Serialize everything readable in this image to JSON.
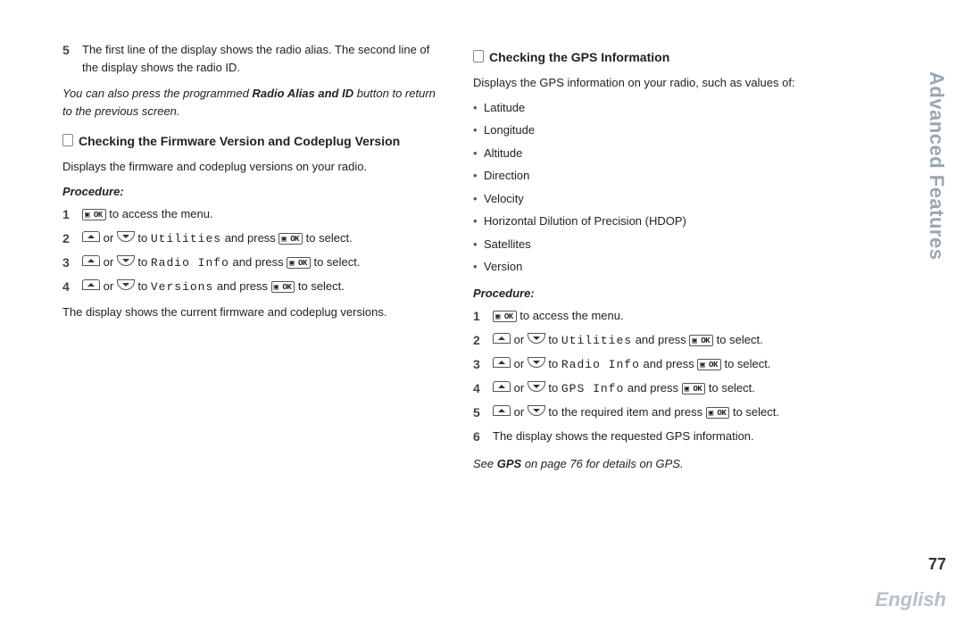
{
  "sideTab": "Advanced Features",
  "pageNumber": "77",
  "language": "English",
  "left": {
    "step5": {
      "num": "5",
      "text": "The first line of the display shows the radio alias. The second line of the display shows the radio ID."
    },
    "note_pre": "You can also press the programmed ",
    "note_bold": "Radio Alias and ID",
    "note_post": " button to return to the previous screen.",
    "section_title": "Checking the Firmware Version and Codeplug Version",
    "intro": "Displays the firmware and codeplug versions on your radio.",
    "procedure_label": "Procedure:",
    "steps": {
      "s1": {
        "num": "1",
        "tail": " to access the menu."
      },
      "s2": {
        "num": "2",
        "mid1": " or ",
        "mid2": " to ",
        "target": "Utilities",
        "mid3": " and press ",
        "tail": " to select."
      },
      "s3": {
        "num": "3",
        "mid1": " or ",
        "mid2": " to ",
        "target": "Radio Info",
        "mid3": " and press ",
        "tail": " to select."
      },
      "s4": {
        "num": "4",
        "mid1": " or ",
        "mid2": " to ",
        "target": "Versions",
        "mid3": " and press ",
        "tail": " to select."
      }
    },
    "outro": "The display shows the current firmware and codeplug versions."
  },
  "right": {
    "section_title": "Checking the GPS Information",
    "intro": "Displays the GPS information on your radio, such as values of:",
    "bullets": [
      "Latitude",
      "Longitude",
      "Altitude",
      "Direction",
      "Velocity",
      "Horizontal Dilution of Precision (HDOP)",
      "Satellites",
      "Version"
    ],
    "procedure_label": "Procedure:",
    "steps": {
      "s1": {
        "num": "1",
        "tail": " to access the menu."
      },
      "s2": {
        "num": "2",
        "mid1": " or ",
        "mid2": " to ",
        "target": "Utilities",
        "mid3": " and press ",
        "tail": " to select."
      },
      "s3": {
        "num": "3",
        "mid1": " or ",
        "mid2": " to ",
        "target": "Radio Info",
        "mid3": " and press ",
        "tail": " to select."
      },
      "s4": {
        "num": "4",
        "mid1": " or ",
        "mid2": " to ",
        "target": "GPS Info",
        "mid3": " and press ",
        "tail": " to select."
      },
      "s5": {
        "num": "5",
        "mid1": " or ",
        "mid2": " to the required item and press ",
        "tail": " to select."
      },
      "s6": {
        "num": "6",
        "text": "The display shows the requested GPS information."
      }
    },
    "footnote_pre": "See ",
    "footnote_bold": "GPS",
    "footnote_post": " on page 76 for details on GPS."
  },
  "buttons": {
    "ok": "▣ OK"
  }
}
